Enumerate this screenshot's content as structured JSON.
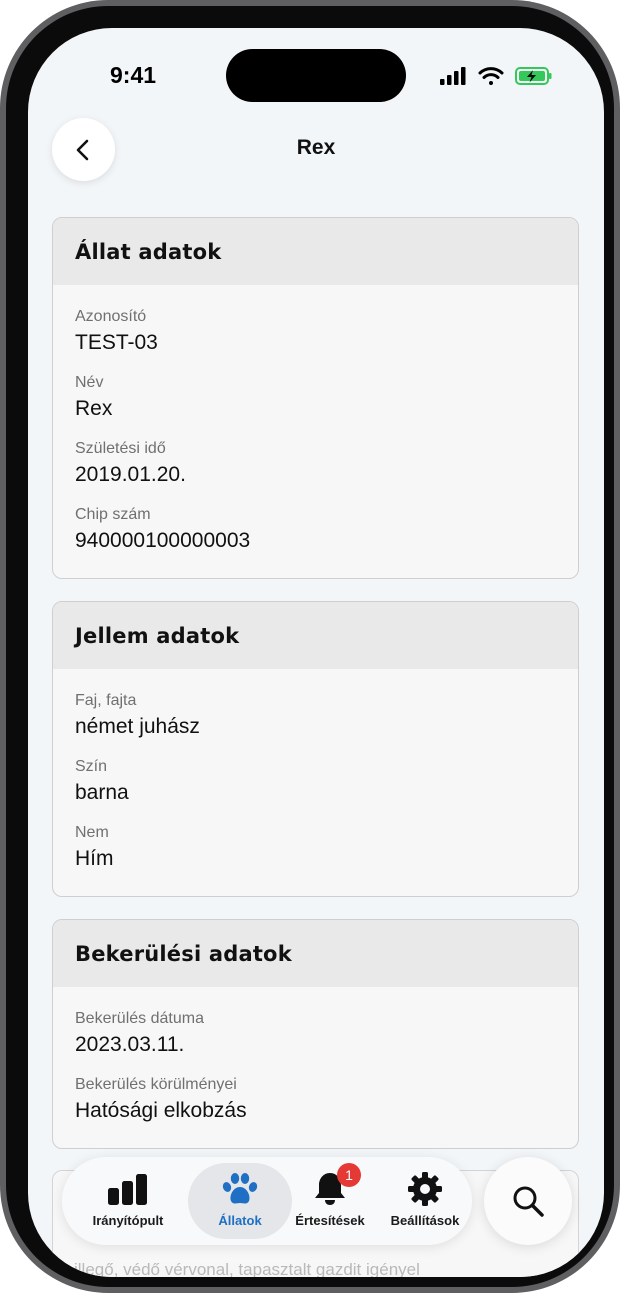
{
  "status_bar": {
    "time": "9:41"
  },
  "header": {
    "title": "Rex"
  },
  "cards": [
    {
      "title": "Állat adatok",
      "fields": [
        {
          "label": "Azonosító",
          "value": "TEST-03"
        },
        {
          "label": "Név",
          "value": "Rex"
        },
        {
          "label": "Születési idő",
          "value": "2019.01.20."
        },
        {
          "label": "Chip szám",
          "value": "940000100000003"
        }
      ]
    },
    {
      "title": "Jellem adatok",
      "fields": [
        {
          "label": "Faj, fajta",
          "value": "német juhász"
        },
        {
          "label": "Szín",
          "value": "barna"
        },
        {
          "label": "Nem",
          "value": "Hím"
        }
      ]
    },
    {
      "title": "Bekerülési adatok",
      "fields": [
        {
          "label": "Bekerülés dátuma",
          "value": "2023.03.11."
        },
        {
          "label": "Bekerülés körülményei",
          "value": "Hatósági elkobzás"
        }
      ]
    }
  ],
  "peek_text": "illegő, védő vérvonal, tapasztalt gazdit igényel",
  "tabbar": {
    "items": [
      {
        "label": "Irányítópult",
        "icon": "bar-chart-icon"
      },
      {
        "label": "Állatok",
        "icon": "paw-icon",
        "active": true
      },
      {
        "label": "Értesítések",
        "icon": "bell-icon",
        "badge": "1"
      },
      {
        "label": "Beállítások",
        "icon": "gear-icon"
      }
    ]
  },
  "colors": {
    "accent": "#1f6fc4",
    "badge": "#e53935",
    "battery": "#34c759",
    "background": "#f3f6f9"
  }
}
